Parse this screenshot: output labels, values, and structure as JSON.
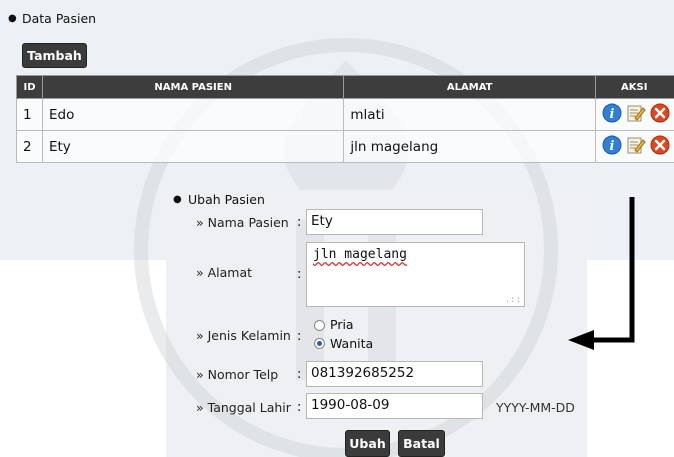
{
  "list": {
    "section_title": "Data Pasien",
    "add_button": "Tambah",
    "columns": [
      "ID",
      "NAMA PASIEN",
      "ALAMAT",
      "AKSI"
    ],
    "rows": [
      {
        "id": "1",
        "nama": "Edo",
        "alamat": "mlati"
      },
      {
        "id": "2",
        "nama": "Ety",
        "alamat": "jln magelang"
      }
    ],
    "action_icons": [
      "info-icon",
      "edit-icon",
      "delete-icon"
    ]
  },
  "form": {
    "section_title": "Ubah Pasien",
    "labels": {
      "nama": "» Nama Pasien",
      "alamat": "» Alamat",
      "jenis_kelamin": "» Jenis Kelamin",
      "telp": "» Nomor Telp",
      "tgl_lahir": "» Tanggal Lahir"
    },
    "colon": ":",
    "values": {
      "nama": "Ety",
      "alamat": "jln magelang",
      "telp": "081392685252",
      "tgl_lahir": "1990-08-09"
    },
    "gender_options": [
      "Pria",
      "Wanita"
    ],
    "gender_selected": "Wanita",
    "date_hint": "YYYY-MM-DD",
    "save_button": "Ubah",
    "cancel_button": "Batal"
  },
  "colors": {
    "header_dark": "#3d3d3d",
    "panel_bg": "#edf0f5",
    "info_blue": "#2f7fd4",
    "delete_red": "#e0451c"
  }
}
